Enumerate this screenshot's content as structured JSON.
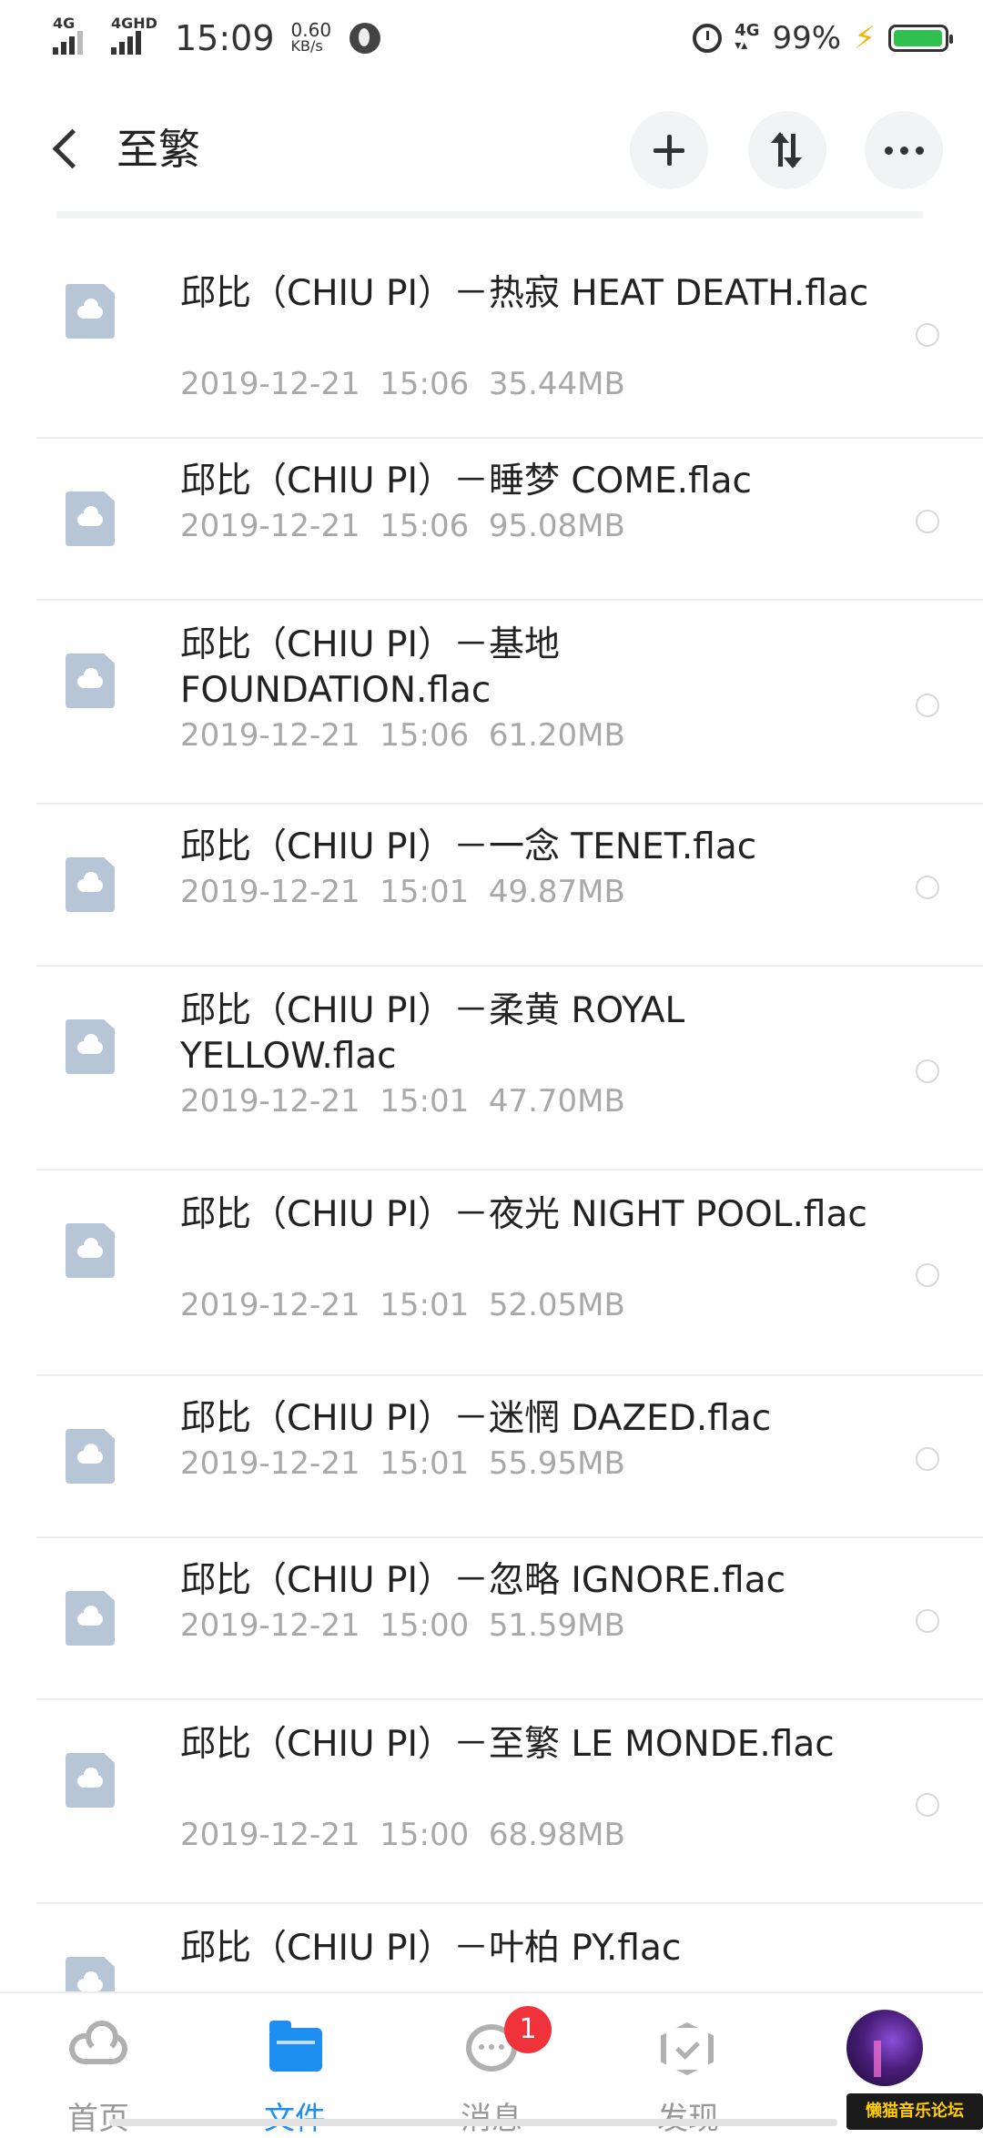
{
  "status_bar": {
    "signal_1_label": "4G",
    "signal_2_label": "4GHD",
    "time": "15:09",
    "net_speed_value": "0.60",
    "net_speed_unit": "KB/s",
    "network_label": "4G",
    "battery_percent": "99%",
    "icons": [
      "signal-icon",
      "signal-hd-icon",
      "globe-icon",
      "alarm-icon",
      "network-4g-icon",
      "charging-bolt-icon",
      "battery-icon"
    ]
  },
  "header": {
    "title": "至繁",
    "buttons": [
      "back-button",
      "add-button",
      "sort-button",
      "more-button"
    ]
  },
  "files": [
    {
      "name": "邱比（CHIU PI）－热寂 HEAT DEATH.flac",
      "date": "2019-12-21",
      "time": "15:06",
      "size": "35.44MB"
    },
    {
      "name": "邱比（CHIU PI）－睡梦 COME.flac",
      "date": "2019-12-21",
      "time": "15:06",
      "size": "95.08MB"
    },
    {
      "name": "邱比（CHIU PI）－基地 FOUNDATION.flac",
      "date": "2019-12-21",
      "time": "15:06",
      "size": "61.20MB"
    },
    {
      "name": "邱比（CHIU PI）－一念 TENET.flac",
      "date": "2019-12-21",
      "time": "15:01",
      "size": "49.87MB"
    },
    {
      "name": "邱比（CHIU PI）－柔黄 ROYAL YELLOW.flac",
      "date": "2019-12-21",
      "time": "15:01",
      "size": "47.70MB"
    },
    {
      "name": "邱比（CHIU PI）－夜光 NIGHT POOL.flac",
      "date": "2019-12-21",
      "time": "15:01",
      "size": "52.05MB"
    },
    {
      "name": "邱比（CHIU PI）－迷惘 DAZED.flac",
      "date": "2019-12-21",
      "time": "15:01",
      "size": "55.95MB"
    },
    {
      "name": "邱比（CHIU PI）－忽略 IGNORE.flac",
      "date": "2019-12-21",
      "time": "15:00",
      "size": "51.59MB"
    },
    {
      "name": "邱比（CHIU PI）－至繁 LE MONDE.flac",
      "date": "2019-12-21",
      "time": "15:00",
      "size": "68.98MB"
    },
    {
      "name": "邱比（CHIU PI）－叶柏 PY.flac",
      "date": "",
      "time": "",
      "size": ""
    }
  ],
  "bottom_nav": {
    "home_label": "首页",
    "files_label": "文件",
    "messages_label": "消息",
    "messages_badge": "1",
    "discover_label": "发现",
    "active": "files"
  },
  "watermark": "懒猫音乐论坛",
  "colors": {
    "accent": "#1e8ff0",
    "badge": "#f0323a",
    "meta_text": "#a8a8a8",
    "file_icon": "#b6c6d6",
    "battery": "#2fc14c",
    "bolt": "#f2b705"
  }
}
